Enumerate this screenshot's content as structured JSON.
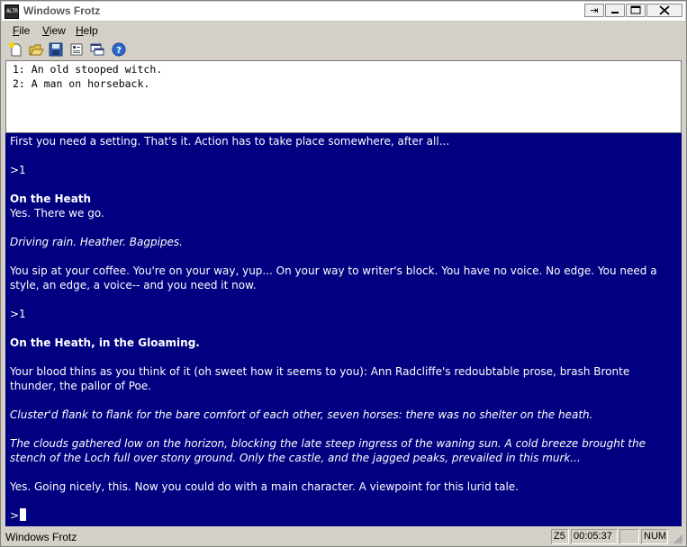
{
  "window": {
    "title": "Windows Frotz",
    "icon_text": "ALTR"
  },
  "titlebar_buttons": {
    "extra": "⇥",
    "minimize": "—",
    "maximize": "□",
    "close": "✕"
  },
  "menu": {
    "file": {
      "accel": "F",
      "rest": "ile"
    },
    "view": {
      "accel": "V",
      "rest": "iew"
    },
    "help": {
      "accel": "H",
      "rest": "elp"
    }
  },
  "toolbar": [
    "new-icon",
    "open-icon",
    "save-icon",
    "properties-icon",
    "windows-icon",
    "help-icon"
  ],
  "status_window": {
    "lines": [
      "1: An old stooped witch.",
      "2: A man on horseback."
    ]
  },
  "game": {
    "p1": "First you need a setting.  That's it.  Action has to take place somewhere, after all...",
    "prompt1": ">1",
    "heading1": "On the Heath",
    "p2": "Yes.  There we go.",
    "p3": "Driving rain.  Heather.  Bagpipes.",
    "p4": "You sip at your coffee.  You're on your way, yup...  On your way to writer's block.  You have no voice.  No edge.  You need a style, an edge, a voice-- and you need it now.",
    "prompt2": ">1",
    "heading2": "On the Heath, in the Gloaming.",
    "p5": "Your blood thins as you think of it (oh sweet how it seems to you): Ann Radcliffe's redoubtable prose, brash Bronte thunder, the pallor of Poe.",
    "p6": "Cluster'd flank to flank for the bare comfort of each other, seven horses: there was no shelter on the heath.",
    "p7": "The clouds gathered low on the horizon, blocking the late steep ingress of the waning sun.  A cold breeze brought the stench of the Loch full over stony ground.  Only the castle, and the jagged peaks, prevailed in this murk...",
    "p8": "Yes.  Going nicely, this.  Now you could do with a main character.  A viewpoint for this lurid tale.",
    "input_prompt": ">"
  },
  "statusbar": {
    "text": "Windows Frotz",
    "version": "Z5",
    "time": "00:05:37",
    "blank": "",
    "num": "NUM"
  },
  "colors": {
    "game_bg": "#000080",
    "game_fg": "#ffffff"
  }
}
